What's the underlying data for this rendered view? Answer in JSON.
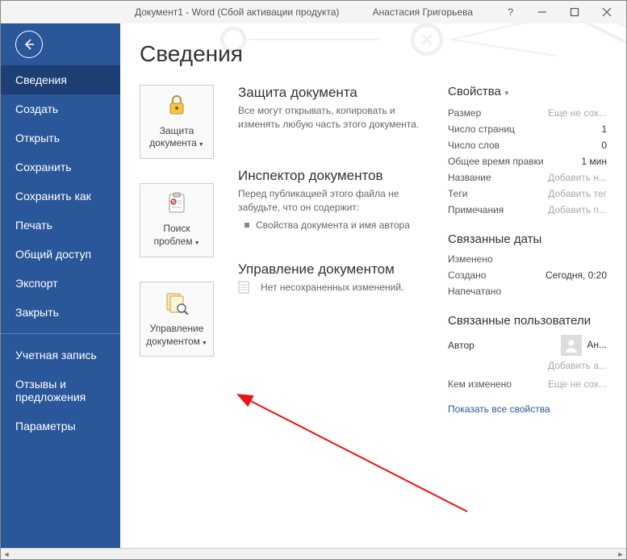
{
  "titlebar": {
    "doc": "Документ1  -  Word  (Сбой активации продукта)",
    "user": "Анастасия Григорьева"
  },
  "sidebar": {
    "items": [
      "Сведения",
      "Создать",
      "Открыть",
      "Сохранить",
      "Сохранить как",
      "Печать",
      "Общий доступ",
      "Экспорт",
      "Закрыть"
    ],
    "footer": [
      "Учетная запись",
      "Отзывы и предложения",
      "Параметры"
    ]
  },
  "page": {
    "title": "Сведения"
  },
  "tiles": {
    "protect": "Защита документа",
    "inspect": "Поиск проблем",
    "manage": "Управление документом"
  },
  "sections": {
    "protect": {
      "title": "Защита документа",
      "desc": "Все могут открывать, копировать и изменять любую часть этого документа."
    },
    "inspect": {
      "title": "Инспектор документов",
      "desc": "Перед публикацией этого файла не забудьте, что он содержит:",
      "bullet": "Свойства документа и имя автора"
    },
    "manage": {
      "title": "Управление документом",
      "desc": "Нет несохраненных изменений."
    }
  },
  "props": {
    "header": "Свойства",
    "rows": {
      "size": {
        "label": "Размер",
        "value": "Еще не сох..."
      },
      "pages": {
        "label": "Число страниц",
        "value": "1"
      },
      "words": {
        "label": "Число слов",
        "value": "0"
      },
      "edittime": {
        "label": "Общее время правки",
        "value": "1 мин"
      },
      "title": {
        "label": "Название",
        "value": "Добавить н..."
      },
      "tags": {
        "label": "Теги",
        "value": "Добавить тег"
      },
      "notes": {
        "label": "Примечания",
        "value": "Добавить п..."
      }
    },
    "dates": {
      "header": "Связанные даты",
      "modified": {
        "label": "Изменено",
        "value": ""
      },
      "created": {
        "label": "Создано",
        "value": "Сегодня, 0:20"
      },
      "printed": {
        "label": "Напечатано",
        "value": ""
      }
    },
    "users": {
      "header": "Связанные пользователи",
      "author_label": "Автор",
      "author_value": "Ан...",
      "add_author": "Добавить а...",
      "modified_by_label": "Кем изменено",
      "modified_by_value": "Еще не сох..."
    },
    "show_all": "Показать все свойства"
  }
}
